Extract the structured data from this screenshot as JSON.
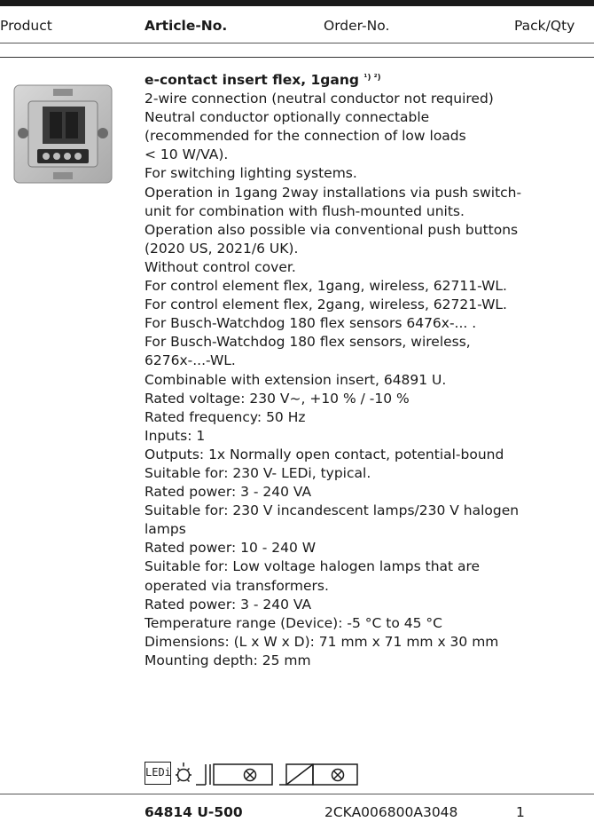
{
  "header": {
    "product": "Product",
    "article_no": "Article-No.",
    "order_no": "Order-No.",
    "pack_qty": "Pack/Qty"
  },
  "item": {
    "title": "e-contact insert flex, 1gang",
    "title_notes": "¹) ²)",
    "lines": [
      "2-wire connection (neutral conductor not required)",
      "Neutral conductor optionally connectable",
      "(recommended for the connection of low loads",
      "< 10 W/VA).",
      "For switching lighting systems.",
      "Operation in 1gang 2way installations via push switch-",
      "unit for combination with flush-mounted units.",
      "Operation also possible via conventional push buttons",
      "(2020 US, 2021/6 UK).",
      "Without control cover.",
      "For control element flex, 1gang, wireless, 62711-WL.",
      "For control element flex, 2gang, wireless, 62721-WL.",
      "For Busch-Watchdog 180 flex sensors 6476x-... .",
      "For Busch-Watchdog 180 flex sensors, wireless,",
      "6276x-...-WL.",
      "Combinable with extension insert, 64891 U.",
      "Rated voltage: 230 V~, +10 % / -10 %",
      "Rated frequency: 50 Hz",
      "Inputs: 1",
      "Outputs: 1x Normally open contact, potential-bound",
      "Suitable for: 230 V- LEDi, typical.",
      "Rated power: 3 - 240 VA",
      "Suitable for: 230 V incandescent lamps/230 V halogen",
      "lamps",
      "Rated power: 10 - 240 W",
      "Suitable for: Low voltage halogen lamps that are",
      "operated via transformers.",
      "Rated power: 3 - 240 VA",
      "Temperature range (Device): -5 °C to 45 °C",
      "Dimensions: (L x W x D): 71 mm x 71 mm x 30 mm",
      "Mounting depth: 25 mm"
    ],
    "icons": [
      "led-dimmable-icon",
      "incandescent-lamp-icon",
      "transformer-halogen-icon",
      "electronic-transformer-icon"
    ],
    "led_icon_label": "LEDi",
    "article_no": "64814 U-500",
    "order_no": "2CKA006800A3048",
    "pack_qty": "1"
  }
}
